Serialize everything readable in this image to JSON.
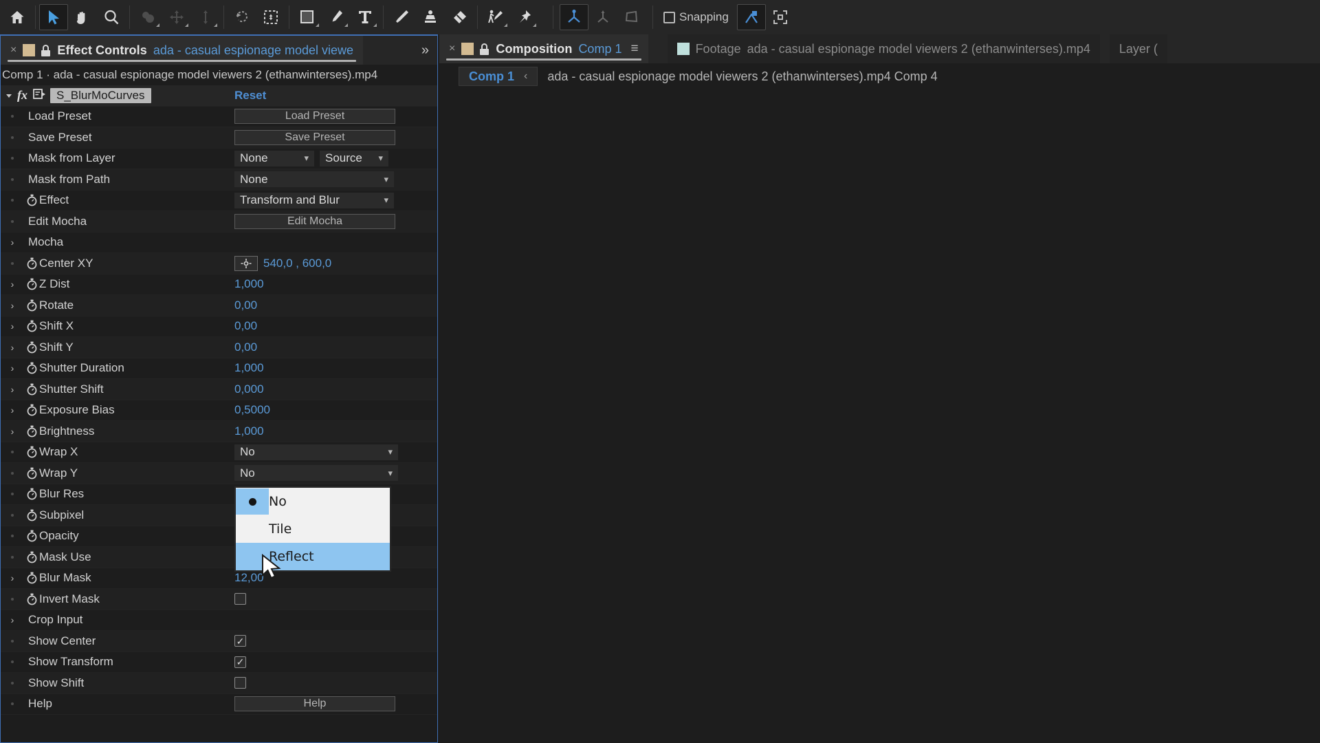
{
  "toolbar": {
    "tools": [
      {
        "name": "home-icon",
        "label": "Home",
        "active": false
      },
      {
        "name": "selection-tool-icon",
        "label": "Selection Tool",
        "active": true
      },
      {
        "name": "hand-tool-icon",
        "label": "Hand Tool",
        "active": false
      },
      {
        "name": "zoom-tool-icon",
        "label": "Zoom Tool",
        "active": false
      },
      {
        "name": "orbit-tool-icon",
        "label": "Orbit Around Cursor",
        "active": false
      },
      {
        "name": "pan-tool-icon",
        "label": "Pan Under Cursor",
        "active": false
      },
      {
        "name": "dolly-tool-icon",
        "label": "Dolly Towards Cursor",
        "active": false
      },
      {
        "name": "rotation-tool-icon",
        "label": "Rotation Tool",
        "active": false
      },
      {
        "name": "anchor-point-tool-icon",
        "label": "Pan Behind Tool",
        "active": false
      },
      {
        "name": "shape-tool-icon",
        "label": "Rectangle Tool",
        "active": false
      },
      {
        "name": "pen-tool-icon",
        "label": "Pen Tool",
        "active": false
      },
      {
        "name": "type-tool-icon",
        "label": "Type Tool",
        "active": false
      },
      {
        "name": "brush-tool-icon",
        "label": "Brush Tool",
        "active": false
      },
      {
        "name": "clone-stamp-tool-icon",
        "label": "Clone Stamp Tool",
        "active": false
      },
      {
        "name": "eraser-tool-icon",
        "label": "Eraser Tool",
        "active": false
      },
      {
        "name": "roto-brush-tool-icon",
        "label": "Roto Brush Tool",
        "active": false
      },
      {
        "name": "puppet-pin-tool-icon",
        "label": "Puppet Pin Tool",
        "active": false
      },
      {
        "name": "unified-camera-icon",
        "label": "Unified Camera",
        "active": true
      },
      {
        "name": "orbit-camera-icon",
        "label": "Orbit Camera",
        "active": false
      },
      {
        "name": "track-camera-icon",
        "label": "Track Camera",
        "active": false
      }
    ],
    "snapping_label": "Snapping",
    "snapping_checked": false,
    "extra_icons": [
      {
        "name": "snapping-mode-icon",
        "active": true
      },
      {
        "name": "transform-box-icon",
        "active": false
      }
    ]
  },
  "effect_controls": {
    "tab": {
      "close_label": "×",
      "title": "Effect Controls",
      "subtitle": "ada - casual espionage model viewe",
      "overflow_label": "»"
    },
    "breadcrumb": "Comp 1 · ada - casual espionage model viewers 2 (ethanwinterses).mp4",
    "effect_name": "S_BlurMoCurves",
    "reset_label": "Reset",
    "rows": [
      {
        "label": "Load Preset",
        "kind": "button",
        "value": "Load Preset",
        "indent": 1,
        "marker": "dot"
      },
      {
        "label": "Save Preset",
        "kind": "button",
        "value": "Save Preset",
        "indent": 1,
        "marker": "dot"
      },
      {
        "label": "Mask from Layer",
        "kind": "dual-dropdown",
        "value": "None",
        "value2": "Source",
        "indent": 1,
        "marker": "dot"
      },
      {
        "label": "Mask from Path",
        "kind": "dropdown-wide",
        "value": "None",
        "indent": 1,
        "marker": "dot"
      },
      {
        "label": "Effect",
        "kind": "dropdown-wide",
        "value": "Transform and Blur",
        "indent": 1,
        "marker": "dot",
        "stopwatch": true
      },
      {
        "label": "Edit Mocha",
        "kind": "button",
        "value": "Edit Mocha",
        "indent": 1,
        "marker": "dot"
      },
      {
        "label": "Mocha",
        "kind": "group",
        "value": "",
        "indent": 0,
        "marker": "triangle"
      },
      {
        "label": "Center XY",
        "kind": "point",
        "value": "540,0 , 600,0",
        "indent": 1,
        "marker": "dot",
        "stopwatch": true
      },
      {
        "label": "Z Dist",
        "kind": "number",
        "value": "1,000",
        "indent": 0,
        "marker": "triangle",
        "stopwatch": true
      },
      {
        "label": "Rotate",
        "kind": "number",
        "value": "0,00",
        "indent": 0,
        "marker": "triangle",
        "stopwatch": true
      },
      {
        "label": "Shift X",
        "kind": "number",
        "value": "0,00",
        "indent": 0,
        "marker": "triangle",
        "stopwatch": true
      },
      {
        "label": "Shift Y",
        "kind": "number",
        "value": "0,00",
        "indent": 0,
        "marker": "triangle",
        "stopwatch": true
      },
      {
        "label": "Shutter Duration",
        "kind": "number",
        "value": "1,000",
        "indent": 0,
        "marker": "triangle",
        "stopwatch": true
      },
      {
        "label": "Shutter Shift",
        "kind": "number",
        "value": "0,000",
        "indent": 0,
        "marker": "triangle",
        "stopwatch": true
      },
      {
        "label": "Exposure Bias",
        "kind": "number",
        "value": "0,5000",
        "indent": 0,
        "marker": "triangle",
        "stopwatch": true
      },
      {
        "label": "Brightness",
        "kind": "number",
        "value": "1,000",
        "indent": 0,
        "marker": "triangle",
        "stopwatch": true
      },
      {
        "label": "Wrap X",
        "kind": "dropdown-wrap",
        "value": "No",
        "indent": 1,
        "marker": "dot",
        "stopwatch": true
      },
      {
        "label": "Wrap Y",
        "kind": "dropdown-wrap",
        "value": "No",
        "indent": 1,
        "marker": "dot",
        "stopwatch": true
      },
      {
        "label": "Blur Res",
        "kind": "hidden",
        "value": "",
        "indent": 1,
        "marker": "dot",
        "stopwatch": true
      },
      {
        "label": "Subpixel",
        "kind": "hidden",
        "value": "",
        "indent": 1,
        "marker": "dot",
        "stopwatch": true
      },
      {
        "label": "Opacity",
        "kind": "hidden",
        "value": "",
        "indent": 1,
        "marker": "dot",
        "stopwatch": true
      },
      {
        "label": "Mask Use",
        "kind": "hidden",
        "value": "",
        "indent": 1,
        "marker": "dot",
        "stopwatch": true
      },
      {
        "label": "Blur Mask",
        "kind": "number",
        "value": "12,00",
        "indent": 0,
        "marker": "triangle",
        "stopwatch": true
      },
      {
        "label": "Invert Mask",
        "kind": "checkbox",
        "value": "off",
        "indent": 1,
        "marker": "dot",
        "stopwatch": true
      },
      {
        "label": "Crop Input",
        "kind": "group",
        "value": "",
        "indent": 0,
        "marker": "triangle"
      },
      {
        "label": "Show Center",
        "kind": "checkbox",
        "value": "on",
        "indent": 1,
        "marker": "dot"
      },
      {
        "label": "Show Transform",
        "kind": "checkbox",
        "value": "on",
        "indent": 1,
        "marker": "dot"
      },
      {
        "label": "Show Shift",
        "kind": "checkbox",
        "value": "off",
        "indent": 1,
        "marker": "dot"
      },
      {
        "label": "Help",
        "kind": "button",
        "value": "Help",
        "indent": 1,
        "marker": "dot"
      }
    ]
  },
  "wrap_menu": {
    "options": [
      {
        "label": "No",
        "selected": true,
        "hovered": false
      },
      {
        "label": "Tile",
        "selected": false,
        "hovered": false
      },
      {
        "label": "Reflect",
        "selected": false,
        "hovered": true
      }
    ]
  },
  "composition": {
    "tab": {
      "close_label": "×",
      "title": "Composition",
      "subtitle": "Comp 1",
      "menu_glyph": "≡"
    },
    "footage_tab": {
      "title": "Footage",
      "subtitle": "ada - casual espionage model viewers 2 (ethanwinterses).mp4"
    },
    "layer_tab": {
      "title": "Layer ("
    },
    "breadcrumb": {
      "comp_label": "Comp 1",
      "back_glyph": "‹",
      "path": "ada - casual espionage model viewers 2 (ethanwinterses).mp4 Comp 4"
    }
  },
  "colors": {
    "accent_blue": "#5b9bd8",
    "panel_bg": "#1d1d1d",
    "toolbar_bg": "#262626",
    "menu_highlight": "#8ec5f0",
    "swatch_tan": "#d3bb92",
    "swatch_teal": "#bfe0dc"
  }
}
